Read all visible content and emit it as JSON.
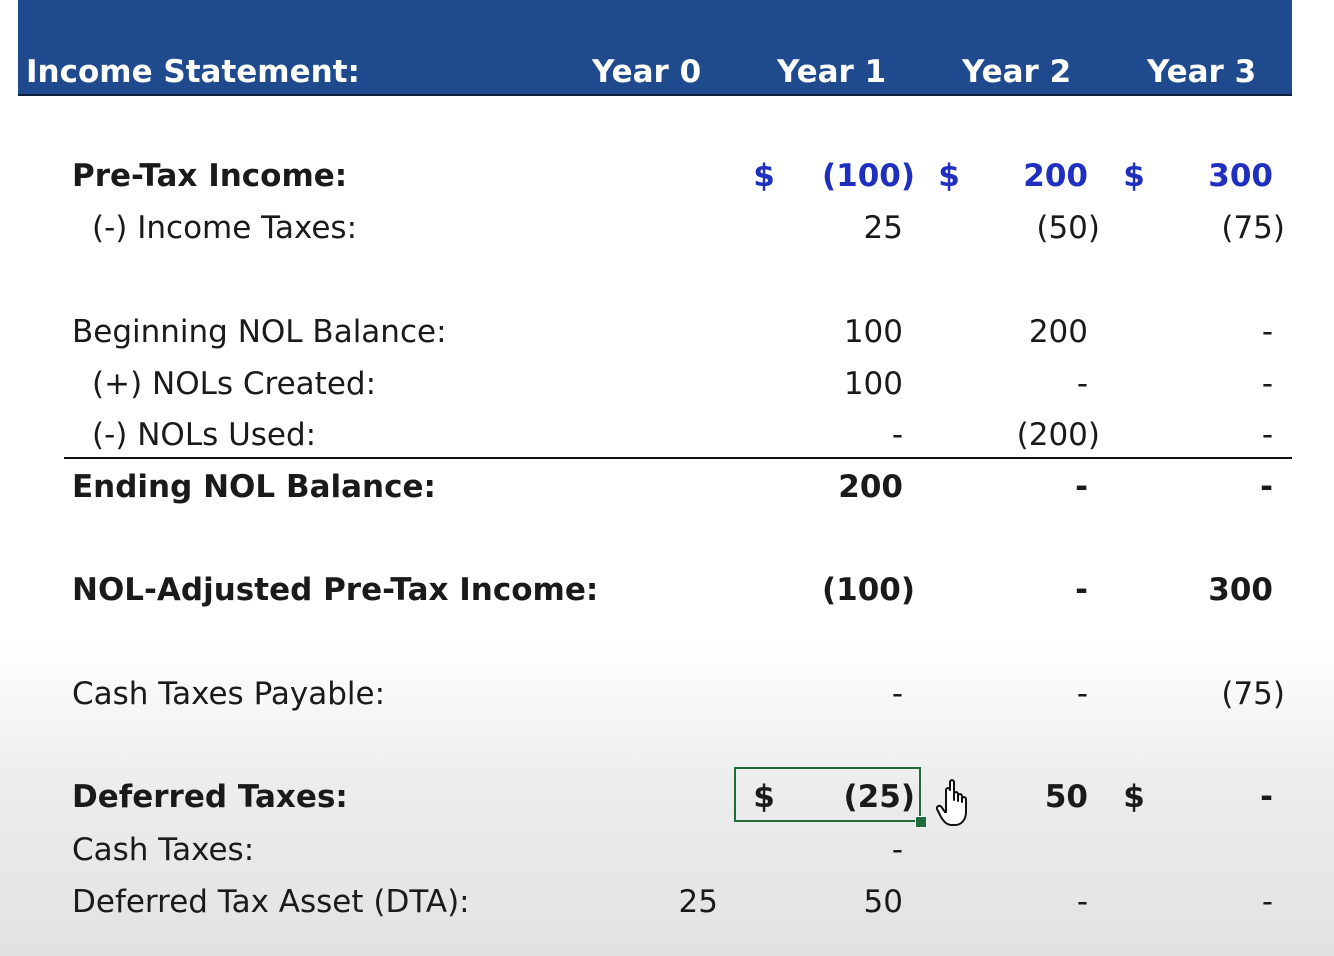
{
  "header": {
    "title": "Income Statement:",
    "years": [
      "Year 0",
      "Year 1",
      "Year 2",
      "Year 3"
    ]
  },
  "rows": {
    "pretax": {
      "label": "Pre-Tax Income:",
      "currency": "$",
      "y1": "(100)",
      "y2": "200",
      "y3": "300"
    },
    "income_taxes": {
      "label": "(-) Income Taxes:",
      "y1": "25",
      "y2": "(50)",
      "y3": "(75)"
    },
    "beg_nol": {
      "label": "Beginning NOL Balance:",
      "y1": "100",
      "y2": "200",
      "y3": "-"
    },
    "nol_created": {
      "label": "(+) NOLs Created:",
      "y1": "100",
      "y2": "-",
      "y3": "-"
    },
    "nol_used": {
      "label": "(-) NOLs Used:",
      "y1": "-",
      "y2": "(200)",
      "y3": "-"
    },
    "end_nol": {
      "label": "Ending NOL Balance:",
      "y1": "200",
      "y2": "-",
      "y3": "-"
    },
    "nol_adj": {
      "label": "NOL-Adjusted Pre-Tax Income:",
      "y1": "(100)",
      "y2": "-",
      "y3": "300"
    },
    "cash_payable": {
      "label": "Cash Taxes Payable:",
      "y1": "-",
      "y2": "-",
      "y3": "(75)"
    },
    "deferred": {
      "label": "Deferred Taxes:",
      "currency": "$",
      "y1": "(25)",
      "y2": "50",
      "y3": "-"
    },
    "cash_taxes": {
      "label": "Cash Taxes:",
      "y1": "-"
    },
    "dta": {
      "label": "Deferred Tax Asset (DTA):",
      "y0": "25",
      "y1": "50",
      "y2": "-",
      "y3": "-"
    }
  },
  "colors": {
    "header_bg": "#1f4b8e",
    "input_blue": "#1f2fbf",
    "selection": "#1f6b3a"
  },
  "cursor": {
    "icon": "hand-pointer-icon"
  }
}
